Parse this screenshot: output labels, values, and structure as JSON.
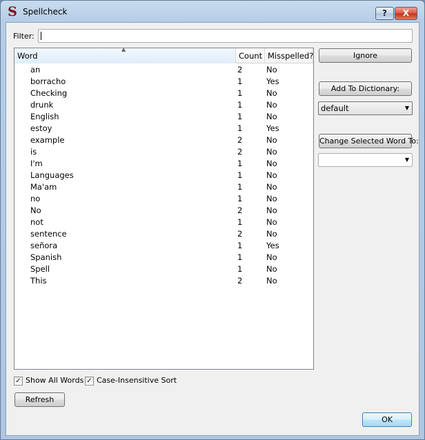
{
  "window": {
    "title": "Spellcheck",
    "help_glyph": "?",
    "close_glyph": "X",
    "icon_glyph": "S"
  },
  "filter": {
    "label": "Filter:",
    "value": ""
  },
  "table": {
    "columns": [
      "Word",
      "Count",
      "Misspelled?"
    ],
    "sort_indicator": "▲",
    "rows": [
      {
        "word": "an",
        "count": "2",
        "misspelled": "No"
      },
      {
        "word": "borracho",
        "count": "1",
        "misspelled": "Yes"
      },
      {
        "word": "Checking",
        "count": "1",
        "misspelled": "No"
      },
      {
        "word": "drunk",
        "count": "1",
        "misspelled": "No"
      },
      {
        "word": "English",
        "count": "1",
        "misspelled": "No"
      },
      {
        "word": "estoy",
        "count": "1",
        "misspelled": "Yes"
      },
      {
        "word": "example",
        "count": "2",
        "misspelled": "No"
      },
      {
        "word": "is",
        "count": "2",
        "misspelled": "No"
      },
      {
        "word": "I'm",
        "count": "1",
        "misspelled": "No"
      },
      {
        "word": "Languages",
        "count": "1",
        "misspelled": "No"
      },
      {
        "word": "Ma'am",
        "count": "1",
        "misspelled": "No"
      },
      {
        "word": "no",
        "count": "1",
        "misspelled": "No"
      },
      {
        "word": "No",
        "count": "2",
        "misspelled": "No"
      },
      {
        "word": "not",
        "count": "1",
        "misspelled": "No"
      },
      {
        "word": "sentence",
        "count": "2",
        "misspelled": "No"
      },
      {
        "word": "señora",
        "count": "1",
        "misspelled": "Yes"
      },
      {
        "word": "Spanish",
        "count": "1",
        "misspelled": "No"
      },
      {
        "word": "Spell",
        "count": "1",
        "misspelled": "No"
      },
      {
        "word": "This",
        "count": "2",
        "misspelled": "No"
      }
    ]
  },
  "actions": {
    "ignore_label": "Ignore",
    "add_label": "Add To Dictionary:",
    "dictionary_selected": "default",
    "change_label": "Change Selected Word To:",
    "change_selected": "",
    "dropdown_glyph": "▼"
  },
  "options": {
    "show_all_label": "Show All Words",
    "show_all_checked": true,
    "case_insensitive_label": "Case-Insensitive Sort",
    "case_insensitive_checked": true,
    "check_glyph": "✓"
  },
  "footer": {
    "refresh_label": "Refresh",
    "ok_label": "OK"
  },
  "colors": {
    "title_gradient_top": "#c9dcef",
    "close_button": "#c1311b",
    "ok_border": "#3c7fb1"
  }
}
